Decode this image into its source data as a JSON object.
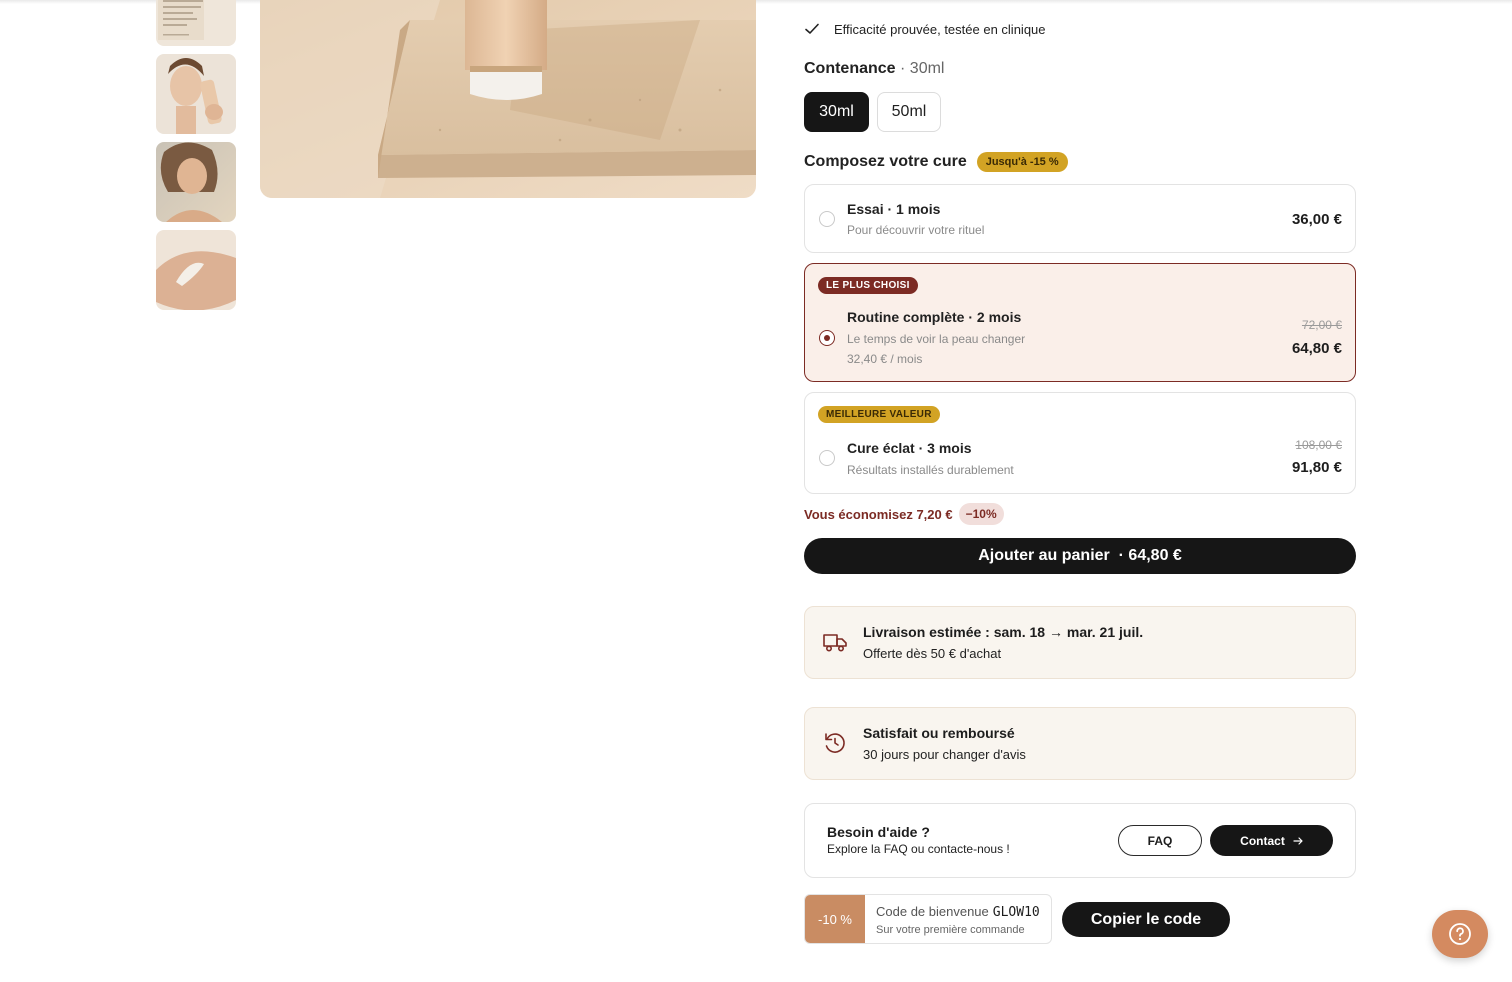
{
  "features": {
    "item_1": "Efficacité prouvée, testée en clinique"
  },
  "contenance": {
    "label": "Contenance",
    "selected_display": "· 30ml",
    "options": [
      "30ml",
      "50ml"
    ]
  },
  "cure": {
    "title": "Composez votre cure",
    "badge": "Jusqu'à -15 %",
    "options": [
      {
        "name": "Essai · 1 mois",
        "desc": "Pour découvrir votre rituel",
        "price": "36,00 €"
      },
      {
        "tag": "LE PLUS CHOISI",
        "name": "Routine complète · 2 mois",
        "desc": "Le temps de voir la peau changer",
        "per_month": "32,40 € / mois",
        "old_price": "72,00 €",
        "price": "64,80 €"
      },
      {
        "tag": "MEILLEURE VALEUR",
        "name": "Cure éclat · 3 mois",
        "desc": "Résultats installés durablement",
        "old_price": "108,00 €",
        "price": "91,80 €"
      }
    ],
    "selected_index": 1
  },
  "savings": {
    "text": "Vous économisez 7,20 €",
    "badge": "−10%"
  },
  "cta": {
    "label": "Ajouter au panier  · 64,80 €"
  },
  "delivery": {
    "title": "Livraison estimée : sam. 18 → mar. 21 juil.",
    "subtitle": "Offerte dès 50 € d'achat",
    "icon": "truck-icon"
  },
  "guarantee": {
    "title": "Satisfait ou remboursé",
    "subtitle": "30 jours pour changer d'avis",
    "icon": "refresh-icon"
  },
  "help": {
    "title": "Besoin d'aide ?",
    "subtitle": "Explore la FAQ ou contacte-nous !",
    "faq_label": "FAQ",
    "contact_label": "Contact"
  },
  "coupon": {
    "discount": "-10 %",
    "label": "Code de bienvenue",
    "code": "GLOW10",
    "note": "Sur votre première commande",
    "copy_label": "Copier le code"
  },
  "colors": {
    "accent": "#7c2b24",
    "gold": "#d2a324",
    "dark": "#161616",
    "fab": "#d48a60"
  }
}
